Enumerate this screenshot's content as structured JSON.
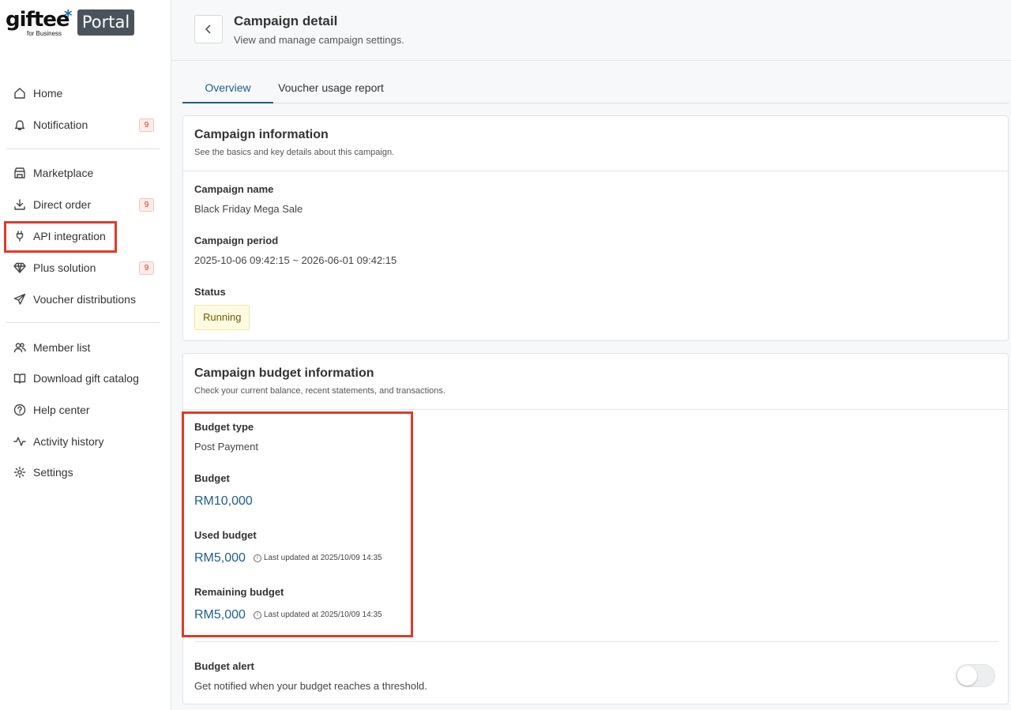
{
  "logo": {
    "word": "giftee",
    "star": "*",
    "sub": "for Business",
    "portal": "Portal"
  },
  "sidebar": {
    "items": [
      {
        "label": "Home",
        "icon": "home-icon"
      },
      {
        "label": "Notification",
        "icon": "bell-icon",
        "badge": "9"
      },
      {
        "label": "Marketplace",
        "icon": "store-icon"
      },
      {
        "label": "Direct order",
        "icon": "download-icon",
        "badge": "9"
      },
      {
        "label": "API integration",
        "icon": "plug-icon"
      },
      {
        "label": "Plus solution",
        "icon": "diamond-icon",
        "badge": "9"
      },
      {
        "label": "Voucher distributions",
        "icon": "send-icon"
      },
      {
        "label": "Member list",
        "icon": "users-icon"
      },
      {
        "label": "Download gift catalog",
        "icon": "book-icon"
      },
      {
        "label": "Help center",
        "icon": "help-icon"
      },
      {
        "label": "Activity history",
        "icon": "activity-icon"
      },
      {
        "label": "Settings",
        "icon": "gear-icon"
      }
    ]
  },
  "header": {
    "title": "Campaign detail",
    "subtitle": "View and manage campaign settings."
  },
  "tabs": [
    {
      "label": "Overview",
      "active": true
    },
    {
      "label": "Voucher usage report",
      "active": false
    }
  ],
  "campaign_info": {
    "title": "Campaign information",
    "desc": "See the basics and key details about this campaign.",
    "name_label": "Campaign name",
    "name_value": "Black Friday Mega Sale",
    "period_label": "Campaign period",
    "period_value": "2025-10-06 09:42:15 ~ 2026-06-01 09:42:15",
    "status_label": "Status",
    "status_value": "Running"
  },
  "budget_info": {
    "title": "Campaign budget information",
    "desc": "Check your current balance, recent statements, and transactions.",
    "type_label": "Budget type",
    "type_value": "Post Payment",
    "budget_label": "Budget",
    "budget_value": "RM10,000",
    "used_label": "Used budget",
    "used_value": "RM5,000",
    "used_updated": "Last updated at 2025/10/09 14:35",
    "remaining_label": "Remaining budget",
    "remaining_value": "RM5,000",
    "remaining_updated": "Last updated at 2025/10/09 14:35",
    "alert_label": "Budget alert",
    "alert_desc": "Get notified when your budget reaches a threshold.",
    "alert_enabled": false
  },
  "colors": {
    "accent": "#1d5f87",
    "highlight": "#e03a2a",
    "status_bg": "#fffbe3",
    "portal_badge": "#4a535c"
  }
}
